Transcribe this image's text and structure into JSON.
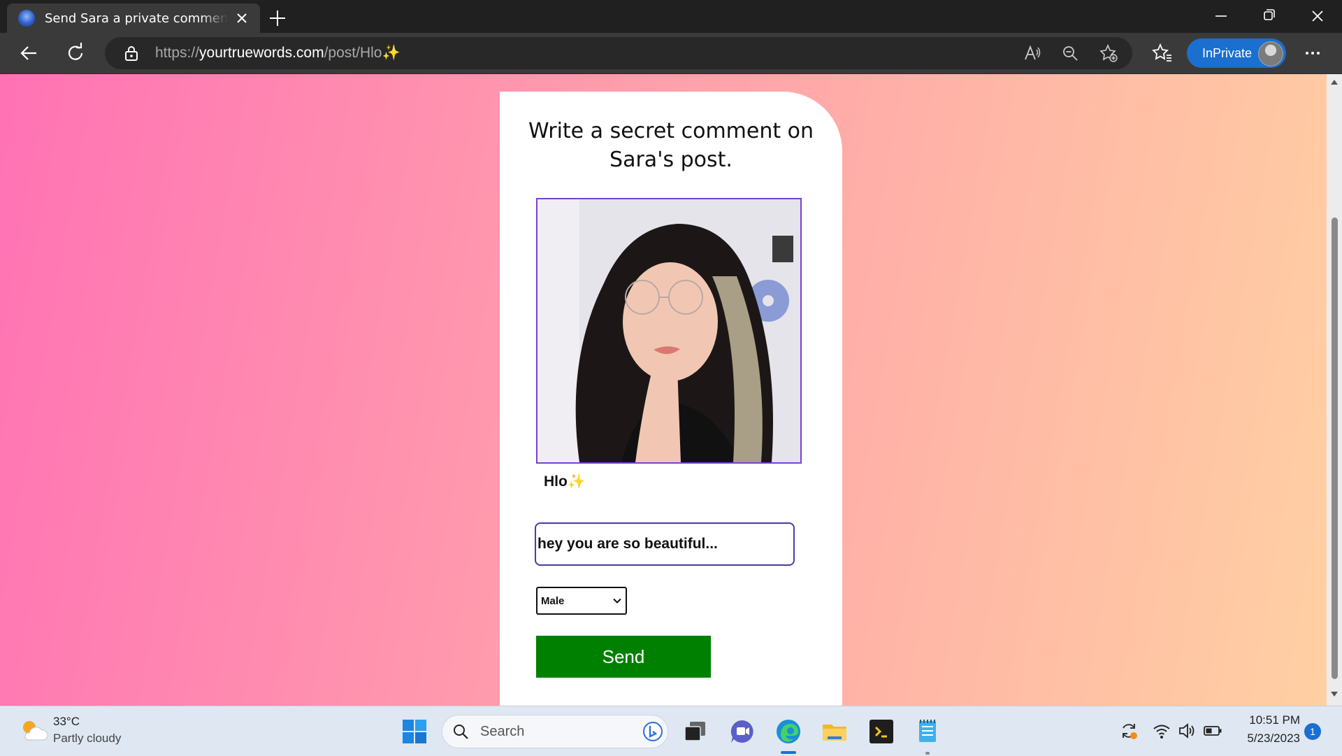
{
  "browser": {
    "tab_title": "Send Sara a private comment on your post",
    "url_scheme": "https://",
    "url_host": "yourtruewords.com",
    "url_path": "/post/Hlo✨",
    "inprivate_label": "InPrivate",
    "accent": "#1a6fd0"
  },
  "page": {
    "heading": "Write a secret comment on Sara's post.",
    "caption": "Hlo✨",
    "comment_value": "hey you are so beautiful...",
    "gender_selected": "Male",
    "send_label": "Send",
    "send_color": "#008000",
    "photo_border_color": "#7b3fd1"
  },
  "taskbar": {
    "weather_temp": "33°C",
    "weather_desc": "Partly cloudy",
    "search_label": "Search",
    "time": "10:51 PM",
    "date": "5/23/2023",
    "notification_count": "1"
  },
  "icons": [
    "edge-favicon-icon",
    "tab-close-icon",
    "new-tab-icon",
    "minimize-icon",
    "maximize-icon",
    "window-close-icon",
    "back-icon",
    "refresh-icon",
    "lock-icon",
    "read-aloud-icon",
    "zoom-out-icon",
    "add-favorite-icon",
    "favorites-icon",
    "more-icon",
    "weather-icon",
    "windows-start-icon",
    "search-icon",
    "bing-icon",
    "task-view-icon",
    "teams-chat-icon",
    "edge-icon",
    "file-explorer-icon",
    "terminal-app-icon",
    "notepad-icon",
    "sync-icon",
    "wifi-icon",
    "volume-icon",
    "battery-icon"
  ]
}
